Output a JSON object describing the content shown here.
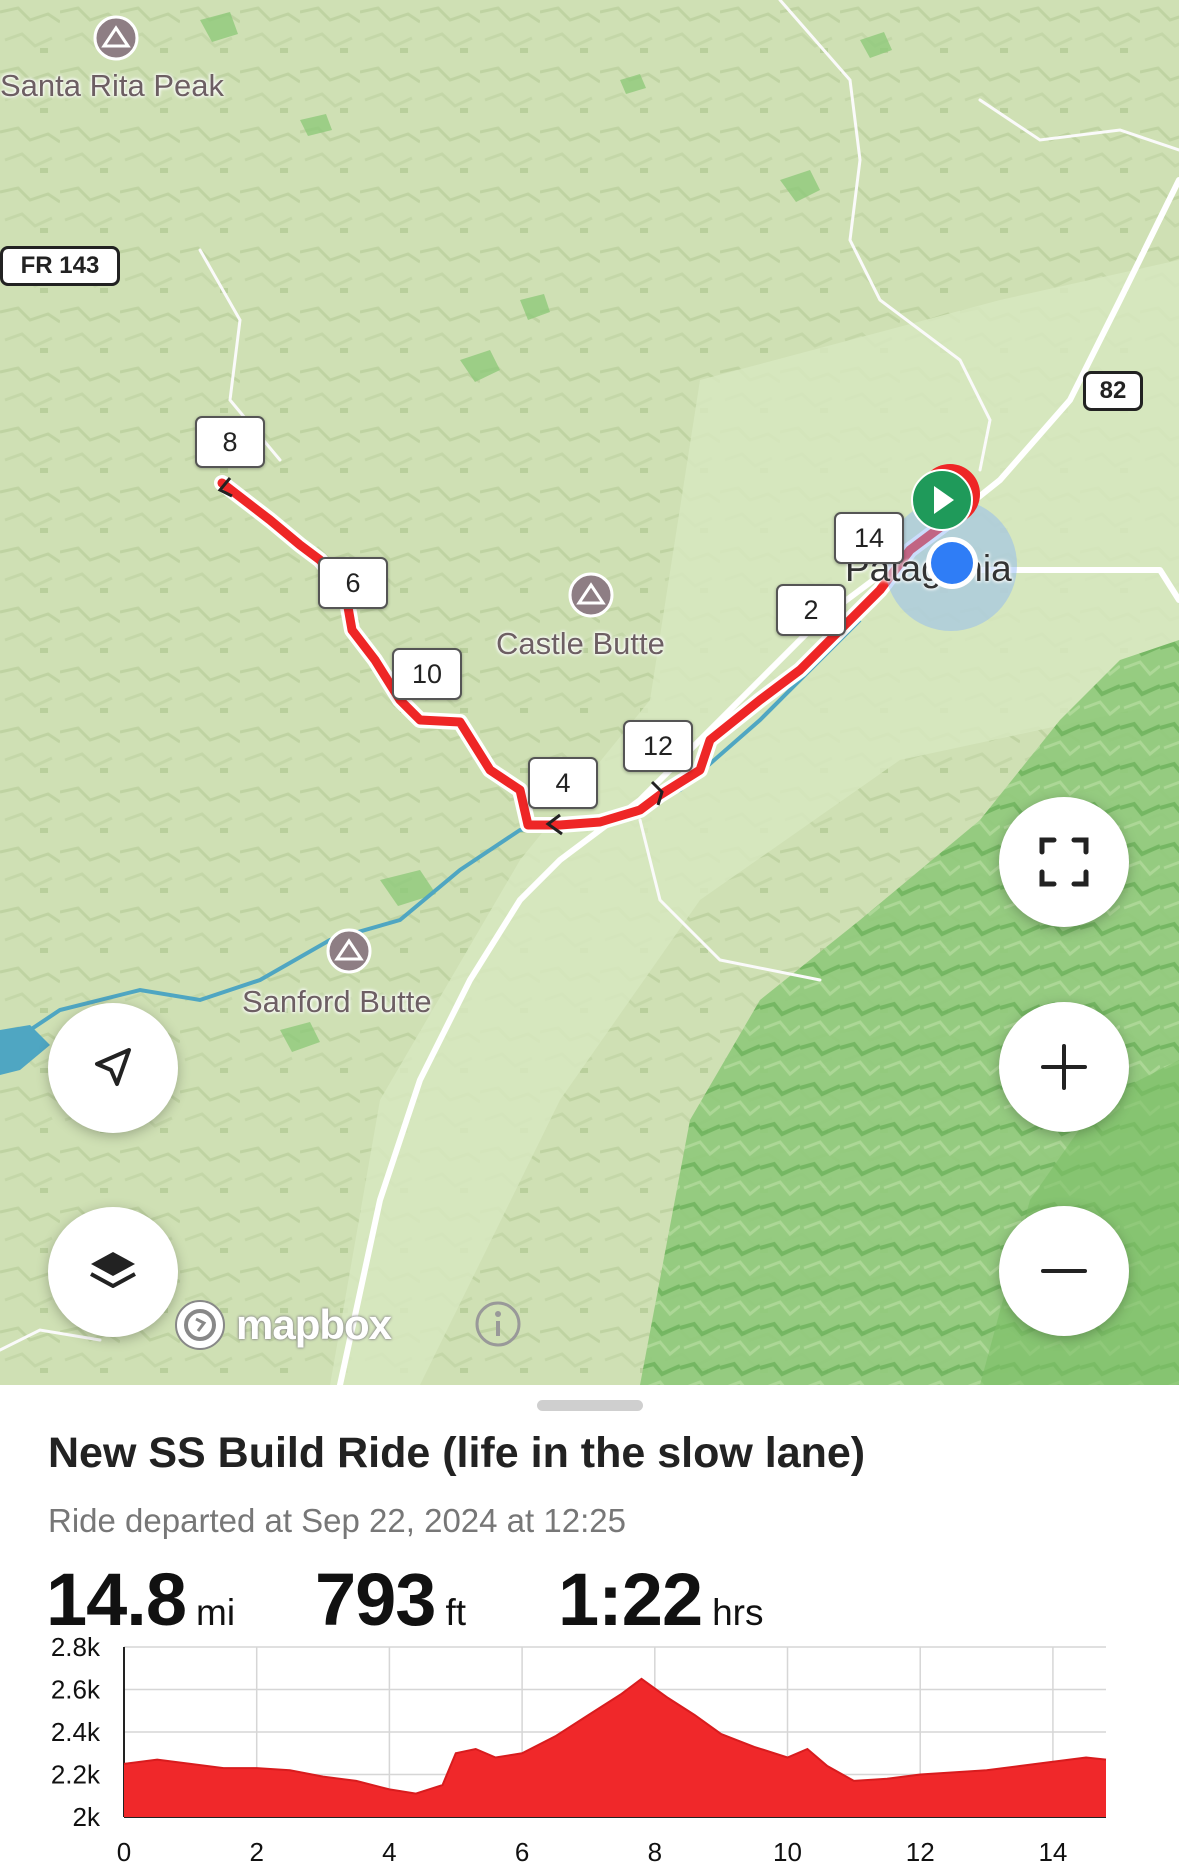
{
  "map": {
    "places": [
      {
        "id": "santa-rita-peak",
        "name": "Santa Rita Peak"
      },
      {
        "id": "castle-butte",
        "name": "Castle Butte"
      },
      {
        "id": "sanford-butte",
        "name": "Sanford Butte"
      },
      {
        "id": "patagonia",
        "name": "Patagonia"
      }
    ],
    "road_shields": {
      "fr143": "FR 143",
      "hwy82": "82"
    },
    "mile_markers": [
      "8",
      "6",
      "10",
      "4",
      "12",
      "2",
      "14"
    ],
    "attribution": "mapbox",
    "route_color": "#ee2626",
    "start_color": "#1f9a5a",
    "location_color": "#2f7df6",
    "controls": {
      "locate": "locate-arrow-icon",
      "layers": "layers-icon",
      "fullscreen": "fullscreen-icon",
      "zoom_in": "plus-icon",
      "zoom_out": "minus-icon",
      "info": "info-icon"
    }
  },
  "ride": {
    "title": "New SS Build Ride (life in the slow lane)",
    "subtitle": "Ride departed at Sep 22, 2024 at 12:25",
    "distance": {
      "value": "14.8",
      "unit": "mi"
    },
    "elevation": {
      "value": "793",
      "unit": "ft"
    },
    "duration": {
      "value": "1:22",
      "unit": "hrs"
    }
  },
  "chart_data": {
    "type": "area",
    "title": "",
    "xlabel": "",
    "ylabel": "",
    "color": "#f0282a",
    "grid": true,
    "xlim": [
      0,
      14.8
    ],
    "ylim": [
      2000,
      2800
    ],
    "x_ticks": [
      "0",
      "2",
      "4",
      "6",
      "8",
      "10",
      "12",
      "14"
    ],
    "y_ticks": [
      "2k",
      "2.2k",
      "2.4k",
      "2.6k",
      "2.8k"
    ],
    "x": [
      0,
      0.5,
      1,
      1.5,
      2,
      2.5,
      3,
      3.5,
      4,
      4.4,
      4.8,
      5,
      5.3,
      5.6,
      6,
      6.5,
      7,
      7.5,
      7.8,
      8.2,
      8.6,
      9,
      9.5,
      10,
      10.3,
      10.6,
      11,
      11.5,
      12,
      12.5,
      13,
      13.5,
      14,
      14.5,
      14.8
    ],
    "y": [
      2250,
      2270,
      2250,
      2230,
      2230,
      2220,
      2190,
      2170,
      2130,
      2110,
      2150,
      2300,
      2320,
      2280,
      2300,
      2380,
      2480,
      2580,
      2650,
      2560,
      2480,
      2390,
      2330,
      2280,
      2320,
      2240,
      2170,
      2180,
      2200,
      2210,
      2220,
      2240,
      2260,
      2280,
      2270
    ]
  }
}
